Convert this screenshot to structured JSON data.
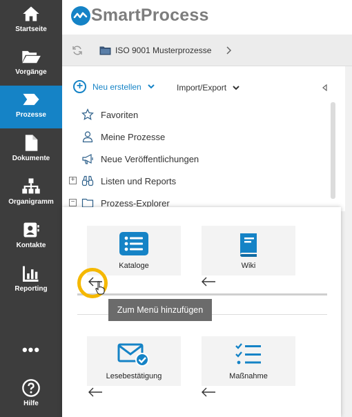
{
  "nav": {
    "items": [
      {
        "label": "Startseite",
        "icon": "home-icon"
      },
      {
        "label": "Vorgänge",
        "icon": "folder-open-icon"
      },
      {
        "label": "Prozesse",
        "icon": "process-arrow-icon",
        "active": true
      },
      {
        "label": "Dokumente",
        "icon": "document-icon"
      },
      {
        "label": "Organigramm",
        "icon": "org-chart-icon"
      },
      {
        "label": "Kontakte",
        "icon": "contact-card-icon"
      },
      {
        "label": "Reporting",
        "icon": "bar-chart-icon"
      }
    ],
    "more_label": "•••",
    "help_label": "Hilfe"
  },
  "header": {
    "brand": "SmartProcess"
  },
  "breadcrumb": {
    "path": "ISO 9001 Musterprozesse"
  },
  "toolbar": {
    "new_label": "Neu erstellen",
    "import_label": "Import/Export"
  },
  "tree": {
    "items": [
      {
        "label": "Favoriten",
        "icon": "star-icon"
      },
      {
        "label": "Meine Prozesse",
        "icon": "person-icon"
      },
      {
        "label": "Neue Veröffentlichungen",
        "icon": "megaphone-icon"
      },
      {
        "label": "Listen und Reports",
        "icon": "binoculars-icon",
        "expander": "+"
      },
      {
        "label": "Prozess-Explorer",
        "icon": "folder-icon",
        "expander": "−"
      }
    ]
  },
  "popup": {
    "tiles": [
      {
        "label": "Kataloge",
        "icon": "list-icon"
      },
      {
        "label": "Wiki",
        "icon": "book-icon"
      },
      {
        "label": "Lesebestätigung",
        "icon": "mail-check-icon"
      },
      {
        "label": "Maßnahme",
        "icon": "checklist-icon"
      }
    ],
    "tooltip": "Zum Menü hinzufügen"
  },
  "colors": {
    "accent": "#1583c6",
    "rail": "#3d3d3d",
    "highlight": "#f5b800"
  }
}
